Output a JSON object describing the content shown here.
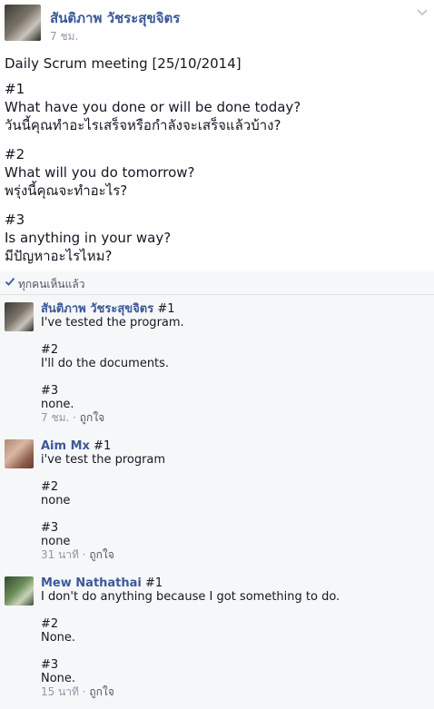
{
  "post": {
    "author": "สันติภาพ วัชระสุขจิตร",
    "timestamp": "7 ชม.",
    "title": "Daily Scrum meeting [25/10/2014]",
    "q1_num": "#1",
    "q1_en": "What have you done or will be done today?",
    "q1_th": "วันนี้คุณทำอะไรเสร็จหรือกำลังจะเสร็จแล้วบ้าง?",
    "q2_num": "#2",
    "q2_en": "What will you do tomorrow?",
    "q2_th": "พรุ่งนี้คุณจะทำอะไร?",
    "q3_num": "#3",
    "q3_en": "Is anything in your way?",
    "q3_th": "มีปัญหาอะไรไหม?",
    "seen_label": "ทุกคนเห็นแล้ว"
  },
  "comments": [
    {
      "name": "สันติภาพ วัชระสุขจิตร",
      "l1": " #1",
      "l2": "I've tested the program.",
      "l3": "#2",
      "l4": "I'll do the documents.",
      "l5": "#3",
      "l6": "none.",
      "time": "7 ชม.",
      "sep": " · ",
      "like": "ถูกใจ"
    },
    {
      "name": "Aim Mx",
      "l1": " #1",
      "l2": "i've test the program",
      "l3": "#2",
      "l4": "none",
      "l5": "#3",
      "l6": "none",
      "time": "31 นาที",
      "sep": " · ",
      "like": "ถูกใจ"
    },
    {
      "name": "Mew Nathathai",
      "l1": " #1",
      "l2": "I don't do anything because I got something to do.",
      "l3": "#2",
      "l4": "None.",
      "l5": "#3",
      "l6": "None.",
      "time": "15 นาที",
      "sep": " · ",
      "like": "ถูกใจ"
    }
  ],
  "icons": {
    "chevron": "chevron-down-icon",
    "check": "check-icon"
  },
  "colors": {
    "name_link": "#3b5998",
    "meta": "#9197a3",
    "comment_bg": "#f6f7f9"
  }
}
